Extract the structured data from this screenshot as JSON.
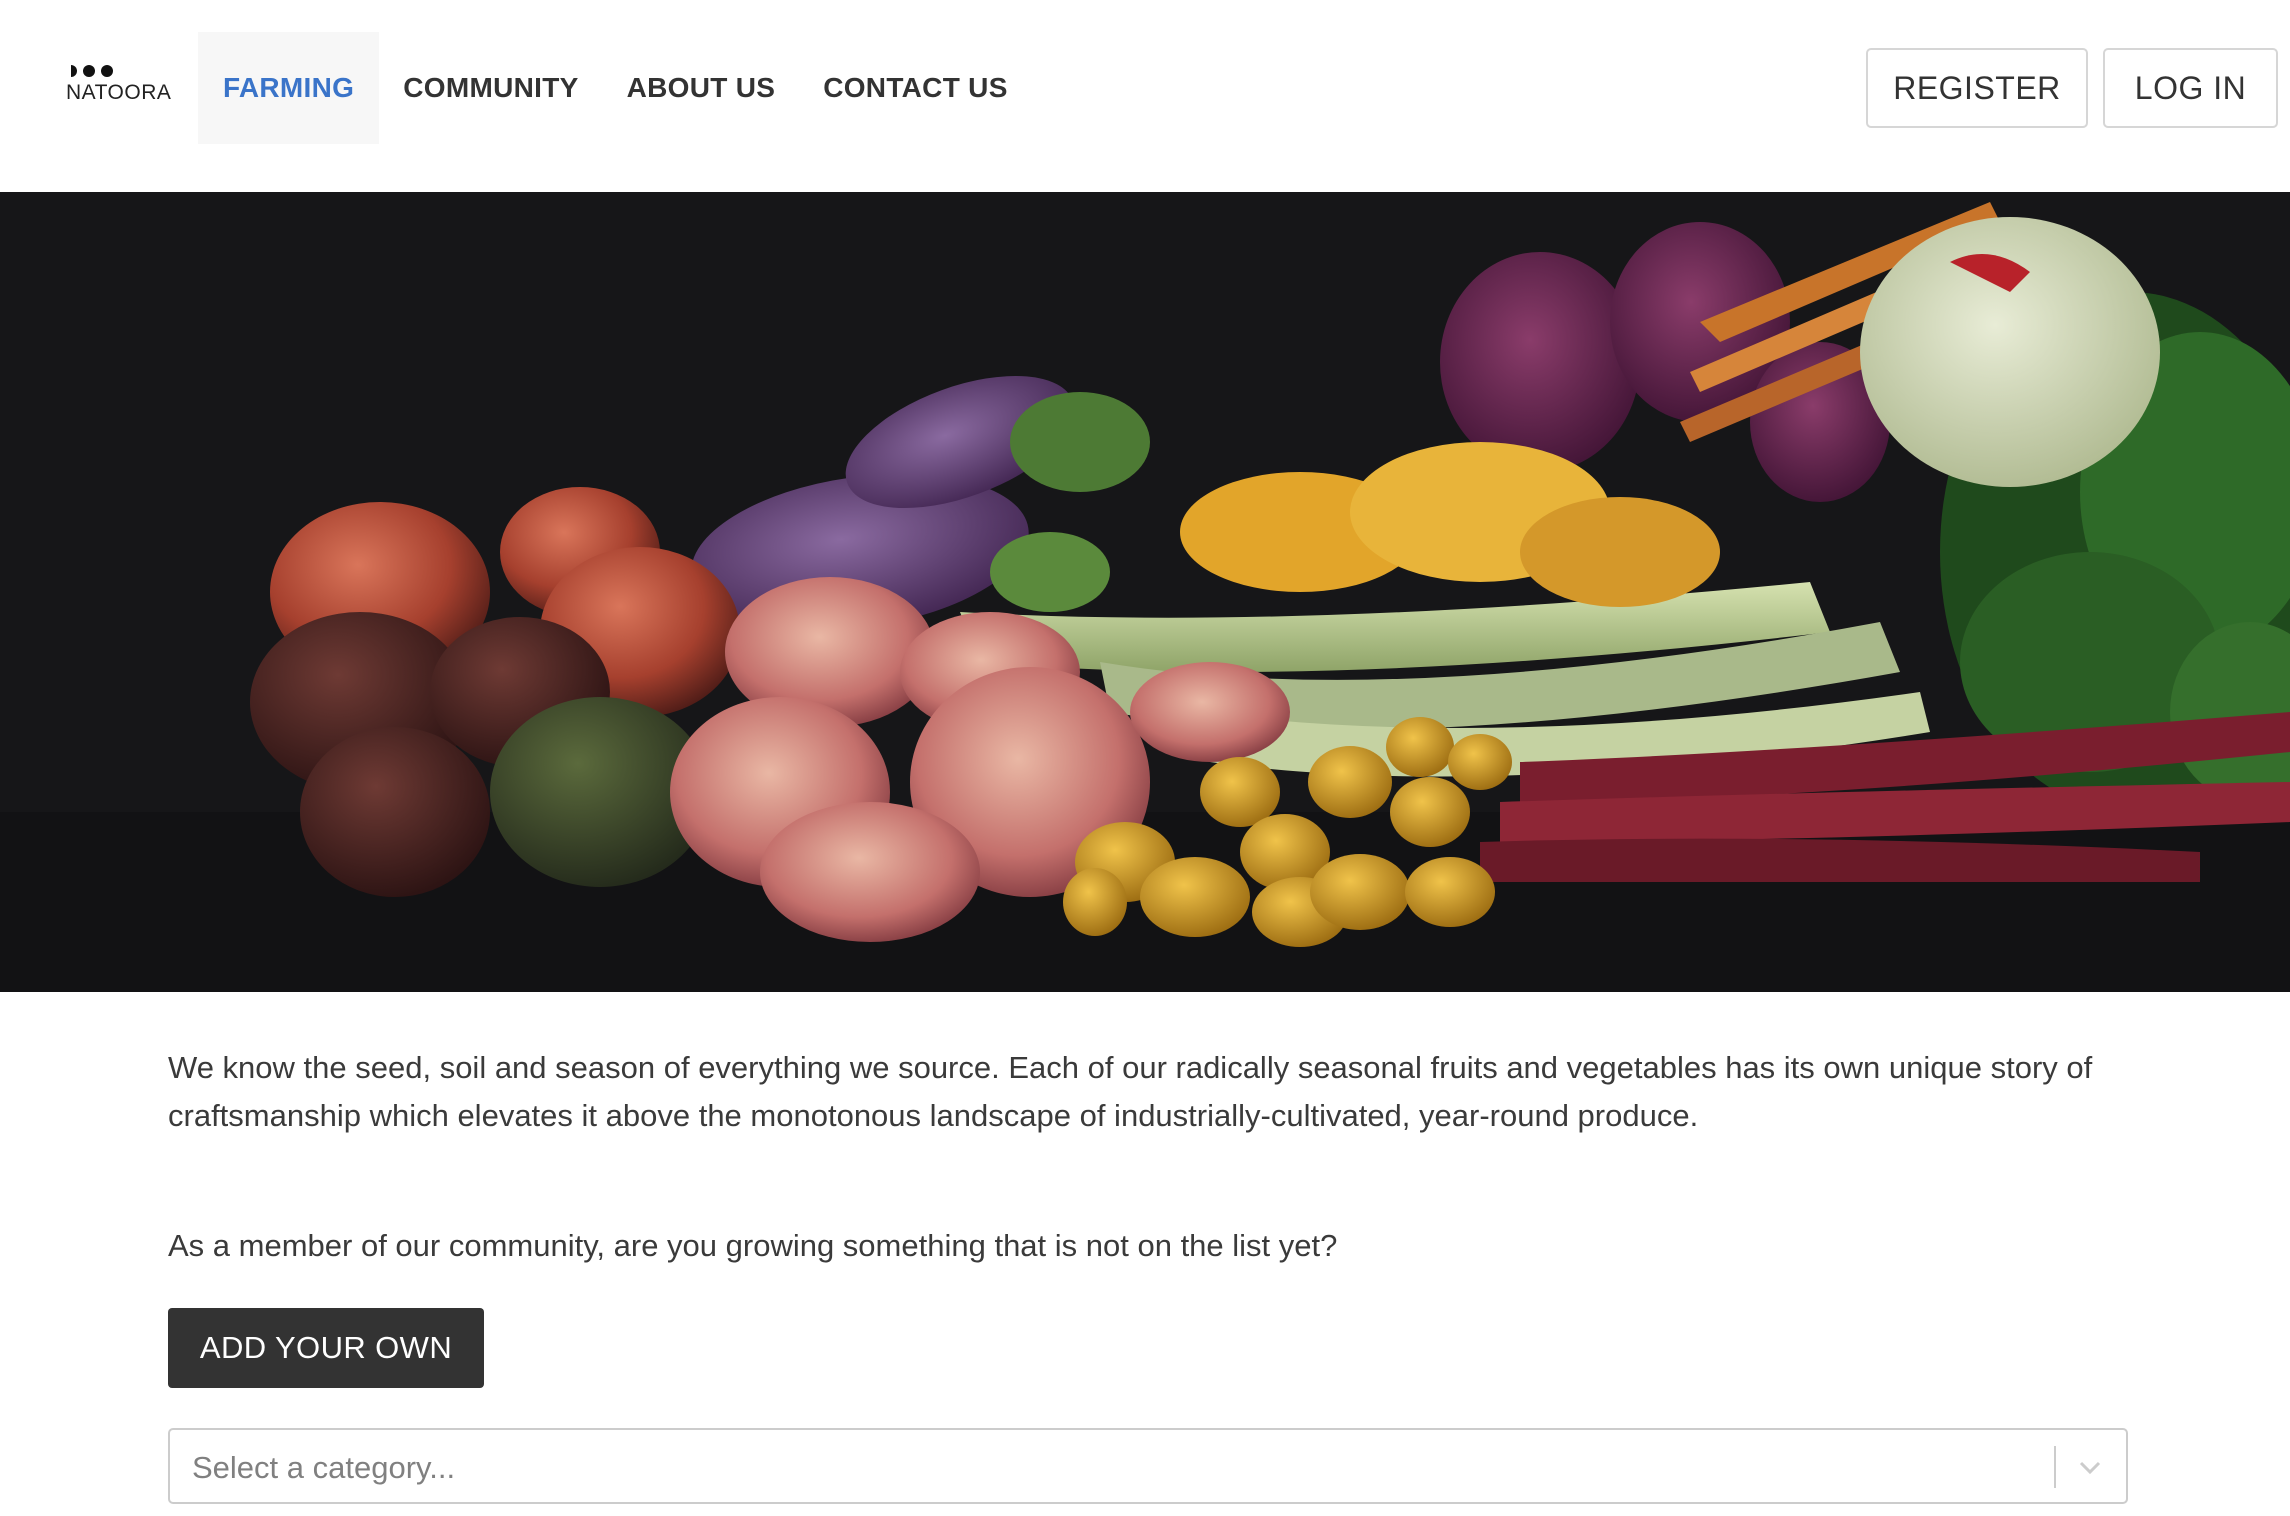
{
  "header": {
    "logo_text": "NATOORA",
    "nav": [
      {
        "label": "FARMING",
        "active": true
      },
      {
        "label": "COMMUNITY",
        "active": false
      },
      {
        "label": "ABOUT US",
        "active": false
      },
      {
        "label": "CONTACT US",
        "active": false
      }
    ],
    "register_label": "REGISTER",
    "login_label": "LOG IN"
  },
  "colors": {
    "active_nav": "#3a74c9",
    "primary_button": "#333333",
    "hero_background": "#161618"
  },
  "main": {
    "intro": "We know the seed, soil and season of everything we source. Each of our radically seasonal fruits and vegetables has its own unique story of craftsmanship which elevates it above the monotonous landscape of industrially-cultivated, year-round produce.",
    "question": "As a member of our community, are you growing something that is not on the list yet?",
    "add_button_label": "ADD YOUR OWN",
    "category_select": {
      "placeholder": "Select a category..."
    }
  },
  "icons": {
    "logo_mark": "three-dots-logo-icon",
    "select_arrow": "chevron-down-icon"
  }
}
